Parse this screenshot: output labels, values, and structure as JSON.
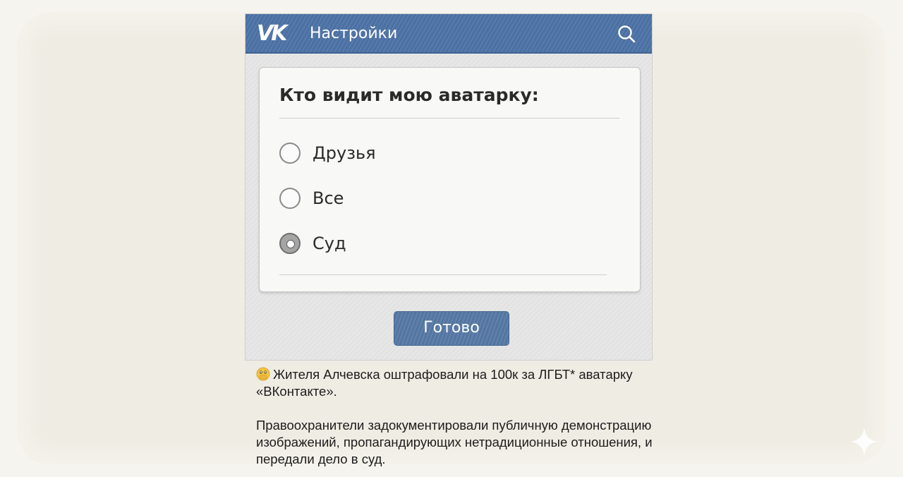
{
  "header": {
    "logo_text": "VK",
    "title": "Настройки",
    "search_icon": "search-icon"
  },
  "dialog": {
    "question": "Кто видит мою аватарку:",
    "options": [
      {
        "label": "Друзья",
        "selected": false
      },
      {
        "label": "Все",
        "selected": false
      },
      {
        "label": "Суд",
        "selected": true
      }
    ],
    "done_label": "Готово"
  },
  "caption": {
    "emoji": "face-with-hand-over-mouth-emoji",
    "headline": "Жителя Алчевска оштрафовали на 100к за ЛГБТ* аватарку «ВКонтакте».",
    "body": "Правоохранители задокументировали публичную демонстрацию изображений, пропагандирующих нетрадиционные отношения, и передали дело в суд."
  },
  "colors": {
    "header_blue": "#4e74a8",
    "button_blue": "#587ba8",
    "background": "#efece3"
  }
}
